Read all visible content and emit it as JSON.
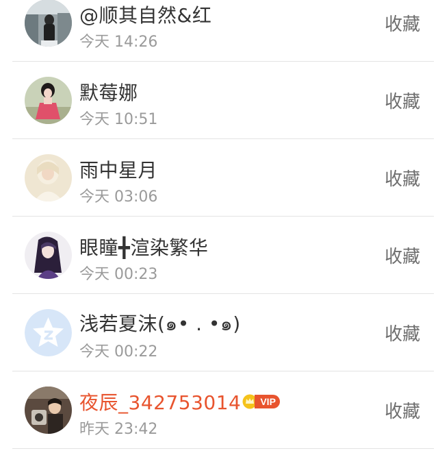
{
  "rows": [
    {
      "name": "@顺其自然&红",
      "time": "今天 14:26",
      "action": "收藏",
      "avatar": "photo-avatar"
    },
    {
      "name": "默莓娜",
      "time": "今天 10:51",
      "action": "收藏",
      "avatar": "photo-avatar"
    },
    {
      "name": "雨中星月",
      "time": "今天 03:06",
      "action": "收藏",
      "avatar": "photo-avatar"
    },
    {
      "name": "眼瞳╋渲染繁华",
      "time": "今天 00:23",
      "action": "收藏",
      "avatar": "photo-avatar"
    },
    {
      "name": "浅若夏沫(๑• . •๑)",
      "time": "今天 00:22",
      "action": "收藏",
      "avatar": "qzone-star-avatar"
    },
    {
      "name": "夜辰_342753014",
      "time": "昨天 23:42",
      "action": "收藏",
      "avatar": "photo-avatar",
      "vip_label": "VIP"
    }
  ],
  "colors": {
    "vip_name": "#e8542e",
    "vip_badge": "#e8542e",
    "crown": "#f5c31b",
    "divider": "#e3e3e3",
    "default_avatar_bg": "#d7e6f8"
  }
}
